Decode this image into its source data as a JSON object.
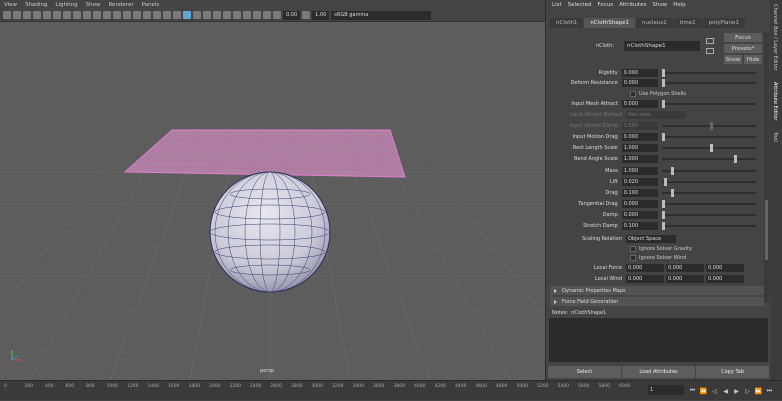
{
  "viewport": {
    "menu": [
      "View",
      "Shading",
      "Lighting",
      "Show",
      "Renderer",
      "Panels"
    ],
    "exposure": "0.00",
    "gamma": "1.00",
    "color_space": "sRGB gamma",
    "camera_label": "persp"
  },
  "attribute_editor": {
    "menu": [
      "List",
      "Selected",
      "Focus",
      "Attributes",
      "Show",
      "Help"
    ],
    "tabs": [
      "nCloth1",
      "nClothShape1",
      "nucleus1",
      "time1",
      "polyPlane1"
    ],
    "active_tab": "nClothShape1",
    "node_type_label": "nCloth:",
    "node_name": "nClothShape1",
    "focus_label": "Focus",
    "presets_label": "Presets*",
    "show_label": "Show",
    "hide_label": "Hide",
    "attributes": [
      {
        "label": "Rigidity",
        "value": "0.000",
        "slider": 0.0,
        "dim": false
      },
      {
        "label": "Deform Resistance",
        "value": "0.000",
        "slider": 0.0,
        "dim": false
      },
      {
        "label": "Input Mesh Attract",
        "value": "0.000",
        "slider": 0.0,
        "dim": false
      },
      {
        "label": "Input Attract Method",
        "value": "Non-zero",
        "slider": null,
        "dim": true
      },
      {
        "label": "Input Attract Damp",
        "value": "0.500",
        "slider": 0.5,
        "dim": true
      },
      {
        "label": "Input Motion Drag",
        "value": "0.000",
        "slider": 0.0,
        "dim": false
      },
      {
        "label": "Rest Length Scale",
        "value": "1.000",
        "slider": 0.5,
        "dim": false
      },
      {
        "label": "Bend Angle Scale",
        "value": "1.000",
        "slider": 0.75,
        "dim": false
      },
      {
        "label": "Mass",
        "value": "1.000",
        "slider": 0.1,
        "dim": false
      },
      {
        "label": "Lift",
        "value": "0.020",
        "slider": 0.02,
        "dim": false
      },
      {
        "label": "Drag",
        "value": "0.100",
        "slider": 0.1,
        "dim": false
      },
      {
        "label": "Tangential Drag",
        "value": "0.000",
        "slider": 0.0,
        "dim": false
      },
      {
        "label": "Damp",
        "value": "0.000",
        "slider": 0.0,
        "dim": false
      },
      {
        "label": "Stretch Damp",
        "value": "0.100",
        "slider": 0.0,
        "dim": false
      }
    ],
    "use_polygon_shells": "Use Polygon Shells",
    "scaling_relation_label": "Scaling Relation",
    "scaling_relation_value": "Object Space",
    "ignore_gravity": "Ignore Solver Gravity",
    "ignore_wind": "Ignore Solver Wind",
    "local_force_label": "Local Force",
    "local_force": [
      "0.000",
      "0.000",
      "0.000"
    ],
    "local_wind_label": "Local Wind",
    "local_wind": [
      "0.000",
      "0.000",
      "0.000"
    ],
    "sections": [
      "Dynamic Properties Maps",
      "Force Field Generation"
    ],
    "notes_label": "Notes:",
    "notes_node": "nClothShape1",
    "buttons": [
      "Select",
      "Load Attributes",
      "Copy Tab"
    ]
  },
  "side_tabs": [
    "Channel Box / Layer Editor",
    "Attribute Editor",
    "Tool"
  ],
  "timeline": {
    "ticks": [
      "0",
      "200",
      "400",
      "600",
      "800",
      "1000",
      "1200",
      "1400",
      "1600",
      "1800",
      "2000",
      "2200",
      "2400",
      "2600",
      "2800",
      "3000",
      "3200",
      "3400",
      "3600",
      "3800",
      "4000",
      "4200",
      "4400",
      "4600",
      "4800",
      "5000",
      "5200",
      "5400",
      "5600",
      "5800",
      "6000"
    ],
    "current_frame": "1"
  }
}
